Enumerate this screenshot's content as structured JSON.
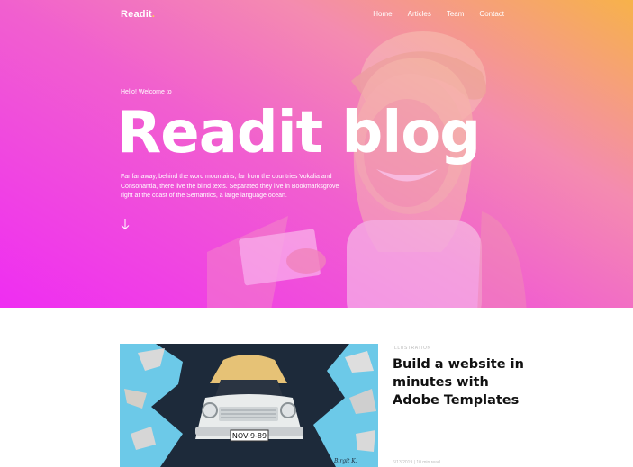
{
  "brand": {
    "name": "Readit",
    "dot": "."
  },
  "nav": {
    "items": [
      "Home",
      "Articles",
      "Team",
      "Contact"
    ]
  },
  "hero": {
    "greeting": "Hello! Welcome to",
    "title": "Readit blog",
    "description": "Far far away, behind the word mountains, far from the countries Vokalia and Consonantia, there live the blind texts. Separated they live in Bookmarksgrove right at the coast of the Semantics, a large language ocean.",
    "arrow_icon": "arrow-down-icon"
  },
  "post": {
    "category": "ILLUSTRATION",
    "title": "Build a website in minutes with Adobe Templates",
    "meta": "6/13/2019 | 10 min read",
    "image": {
      "plate": "NOV-9-89",
      "signature": "Birgit K."
    }
  },
  "colors": {
    "gradient_top_right": "#f7b24a",
    "gradient_bottom_left": "#ef2df2",
    "accent": "#ffd54a",
    "sky": "#6cc9e8"
  }
}
